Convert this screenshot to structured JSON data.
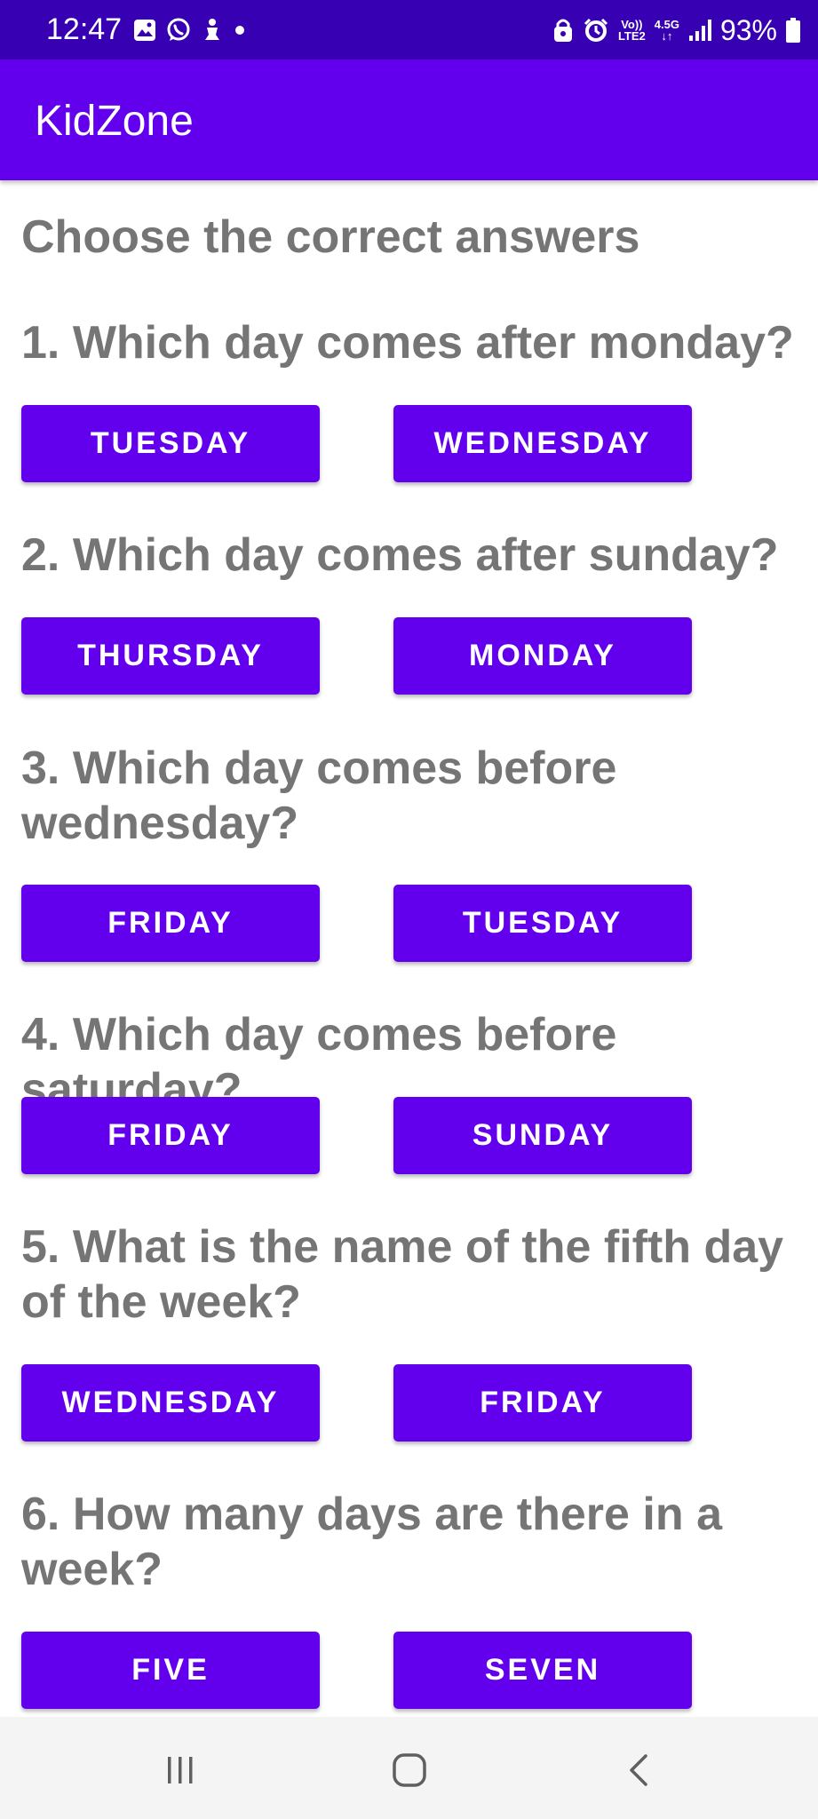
{
  "status_bar": {
    "time": "12:47",
    "battery": "93%",
    "network": {
      "line1": "Vo))",
      "line2": "LTE2",
      "speed": "4.5G"
    },
    "icons_left": [
      "gallery-icon",
      "whatsapp-icon",
      "notification-icon",
      "dot-icon"
    ],
    "icons_right": [
      "lock-icon",
      "alarm-icon",
      "signal-icon",
      "battery-icon"
    ]
  },
  "app_bar": {
    "title": "KidZone"
  },
  "quiz": {
    "heading": "Choose the correct answers",
    "questions": [
      {
        "text": "1. Which day comes after monday?",
        "options": [
          "TUESDAY",
          "WEDNESDAY"
        ]
      },
      {
        "text": "2. Which day comes after sunday?",
        "options": [
          "THURSDAY",
          "MONDAY"
        ]
      },
      {
        "text": "3. Which day comes before wednesday?",
        "options": [
          "FRIDAY",
          "TUESDAY"
        ]
      },
      {
        "text": "4. Which day comes before saturday?",
        "options": [
          "FRIDAY",
          "SUNDAY"
        ]
      },
      {
        "text": "5. What is the name of the fifth day of the week?",
        "options": [
          "WEDNESDAY",
          "FRIDAY"
        ]
      },
      {
        "text": "6. How many days are there in a week?",
        "options": [
          "FIVE",
          "SEVEN"
        ]
      }
    ]
  },
  "nav_bar": {
    "icons": [
      "recents-icon",
      "home-icon",
      "back-icon"
    ]
  },
  "colors": {
    "primary": "#6200ee",
    "primary_dark": "#3700b3",
    "text_gray": "#757575"
  }
}
